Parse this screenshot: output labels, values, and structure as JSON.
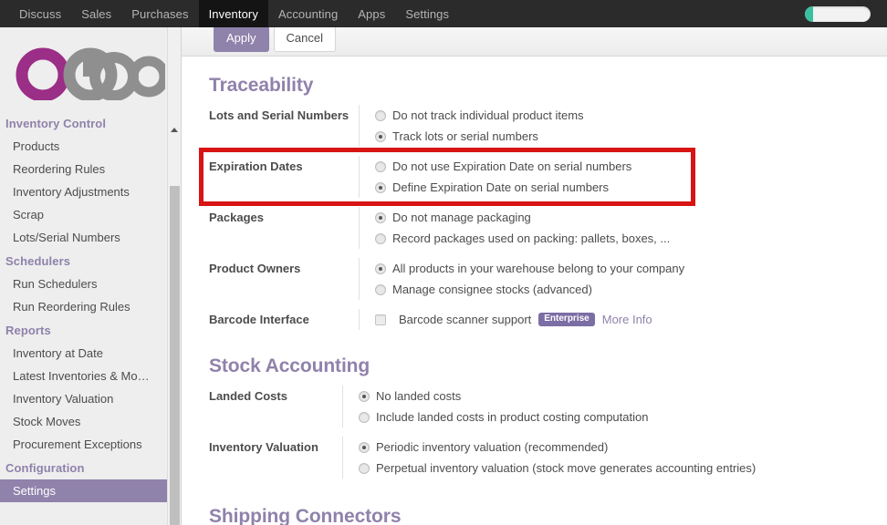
{
  "navbar": {
    "items": [
      {
        "label": "Discuss",
        "active": false
      },
      {
        "label": "Sales",
        "active": false
      },
      {
        "label": "Purchases",
        "active": false
      },
      {
        "label": "Inventory",
        "active": true
      },
      {
        "label": "Accounting",
        "active": false
      },
      {
        "label": "Apps",
        "active": false
      },
      {
        "label": "Settings",
        "active": false
      }
    ],
    "progress": {
      "name": "progress-bar",
      "percent": 13,
      "fill_color": "#3bbfa0",
      "track_color": "#f2f2f2"
    }
  },
  "control_panel": {
    "apply_label": "Apply",
    "cancel_label": "Cancel"
  },
  "sidebar": {
    "logo_alt": "odoo",
    "logo_accent_color": "#9b2e86",
    "logo_gray_color": "#8f8f8f",
    "groups": [
      {
        "title": "Inventory Control",
        "items": [
          {
            "label": "Products",
            "active": false
          },
          {
            "label": "Reordering Rules",
            "active": false
          },
          {
            "label": "Inventory Adjustments",
            "active": false
          },
          {
            "label": "Scrap",
            "active": false
          },
          {
            "label": "Lots/Serial Numbers",
            "active": false
          }
        ]
      },
      {
        "title": "Schedulers",
        "items": [
          {
            "label": "Run Schedulers",
            "active": false
          },
          {
            "label": "Run Reordering Rules",
            "active": false
          }
        ]
      },
      {
        "title": "Reports",
        "items": [
          {
            "label": "Inventory at Date",
            "active": false
          },
          {
            "label": "Latest Inventories & Mo…",
            "active": false
          },
          {
            "label": "Inventory Valuation",
            "active": false
          },
          {
            "label": "Stock Moves",
            "active": false
          },
          {
            "label": "Procurement Exceptions",
            "active": false
          }
        ]
      },
      {
        "title": "Configuration",
        "items": [
          {
            "label": "Settings",
            "active": true
          }
        ]
      }
    ]
  },
  "main": {
    "sections": [
      {
        "title": "Traceability",
        "rows": [
          {
            "label": "Lots and Serial Numbers",
            "options": [
              {
                "type": "radio",
                "label": "Do not track individual product items",
                "selected": false
              },
              {
                "type": "radio",
                "label": "Track lots or serial numbers",
                "selected": true
              }
            ]
          },
          {
            "label": "Expiration Dates",
            "highlighted": true,
            "options": [
              {
                "type": "radio",
                "label": "Do not use Expiration Date on serial numbers",
                "selected": false
              },
              {
                "type": "radio",
                "label": "Define Expiration Date on serial numbers",
                "selected": true
              }
            ]
          },
          {
            "label": "Packages",
            "options": [
              {
                "type": "radio",
                "label": "Do not manage packaging",
                "selected": true
              },
              {
                "type": "radio",
                "label": "Record packages used on packing: pallets, boxes, ...",
                "selected": false
              }
            ]
          },
          {
            "label": "Product Owners",
            "options": [
              {
                "type": "radio",
                "label": "All products in your warehouse belong to your company",
                "selected": true
              },
              {
                "type": "radio",
                "label": "Manage consignee stocks (advanced)",
                "selected": false
              }
            ]
          },
          {
            "label": "Barcode Interface",
            "options": [
              {
                "type": "checkbox",
                "label": "Barcode scanner support",
                "selected": false,
                "badge": "Enterprise",
                "link": "More Info"
              }
            ]
          }
        ]
      },
      {
        "title": "Stock Accounting",
        "rows": [
          {
            "label": "Landed Costs",
            "options": [
              {
                "type": "radio",
                "label": "No landed costs",
                "selected": true
              },
              {
                "type": "radio",
                "label": "Include landed costs in product costing computation",
                "selected": false
              }
            ]
          },
          {
            "label": "Inventory Valuation",
            "options": [
              {
                "type": "radio",
                "label": "Periodic inventory valuation (recommended)",
                "selected": true
              },
              {
                "type": "radio",
                "label": "Perpetual inventory valuation (stock move generates accounting entries)",
                "selected": false
              }
            ]
          }
        ]
      },
      {
        "title": "Shipping Connectors",
        "rows": []
      }
    ]
  },
  "annotation": {
    "color": "#d81414",
    "target": "Expiration Dates"
  }
}
